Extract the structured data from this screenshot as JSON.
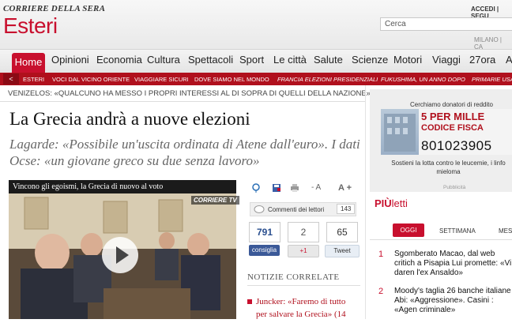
{
  "header": {
    "logo": "CORRIERE DELLA SERA",
    "section": "Esteri",
    "login": "ACCEDI | SEGU",
    "search_placeholder": "Cerca",
    "city": "MILANO | CA"
  },
  "nav": {
    "items": [
      "Home",
      "Opinioni",
      "Economia",
      "Cultura",
      "Spettacoli",
      "Sport",
      "Le città",
      "Salute",
      "Scienze",
      "Motori",
      "Viaggi",
      "27ora",
      "A"
    ]
  },
  "subnav": {
    "back": "<",
    "items": [
      "ESTERI",
      "VOCI DAL VICINO ORIENTE",
      "VIAGGIARE SICURI",
      "DOVE SIAMO NEL MONDO",
      "FRANCIA ELEZIONI PRESIDENZIALI",
      "FUKUSHIMA, UN ANNO DOPO",
      "PRIMARIE USA"
    ]
  },
  "article": {
    "kicker": "VENIZELOS: «QUALCUNO HA MESSO I PROPRI INTERESSI AL DI SOPRA DI QUELLI DELLA NAZIONE»",
    "headline": "La Grecia andrà a nuove elezioni",
    "subhead": "Lagarde: «Possibile un'uscita ordinata di Atene dall'euro». I dati Ocse: «un giovane greco su due senza lavoro»",
    "video_title": "Vincono gli egoismi, la Grecia di nuovo al voto",
    "video_logo": "CORRIERE TV"
  },
  "tools": {
    "font_small": "- A",
    "font_big": "A +",
    "comments_label": "Commenti dei lettori",
    "comments_count": "143",
    "counts": [
      "791",
      "2",
      "65"
    ],
    "fb_label": "consiglia",
    "gplus_label": "+1",
    "tweet_label": "Tweet"
  },
  "related": {
    "title": "NOTIZIE CORRELATE",
    "items": [
      "Juncker: «Faremo di tutto per salvare la Grecia» (14"
    ]
  },
  "ad": {
    "title": "Cerchiamo donatori di reddito",
    "big": "5 PER MILLE",
    "code_label": "CODICE FISCA",
    "code": "801023905",
    "text": "Sostieni la lotta contro le leucemie, i linfo mieloma",
    "label": "Pubblicità"
  },
  "piu_letti": {
    "title_a": "PIÙ",
    "title_b": "letti",
    "tabs": [
      "OGGI",
      "SETTIMANA",
      "MES"
    ],
    "items": [
      {
        "num": "1",
        "text": "Sgomberato Macao, dal web critich a Pisapia Lui promette: «Vi daren l'ex Ansaldo»"
      },
      {
        "num": "2",
        "text": "Moody's taglia 26 banche italiane Abi: «Aggressione». Casini : «Agen criminale»"
      }
    ]
  }
}
